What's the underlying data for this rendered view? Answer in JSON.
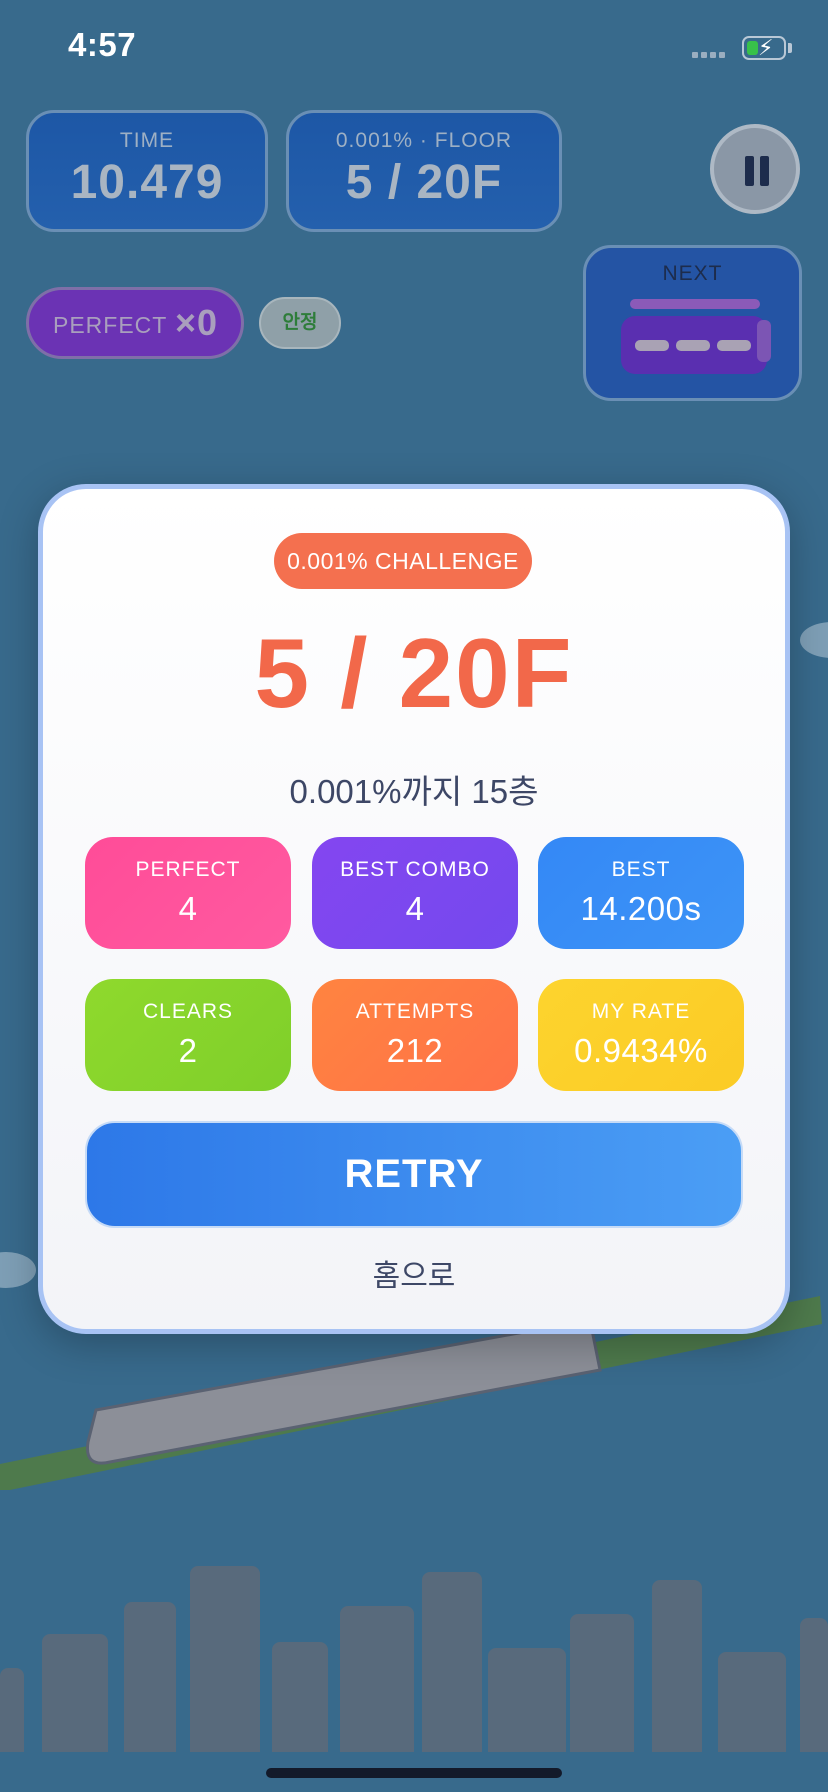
{
  "status_bar": {
    "time": "4:57"
  },
  "hud": {
    "time_label": "TIME",
    "time_value": "10.479",
    "floor_label": "0.001% · FLOOR",
    "floor_value": "5 / 20F",
    "combo_label": "PERFECT",
    "combo_value": "×0",
    "stability": "안정",
    "next_label": "NEXT"
  },
  "result": {
    "challenge_badge": "0.001% CHALLENGE",
    "floor": "5 / 20F",
    "remaining": "0.001%까지 15층",
    "stats": [
      {
        "label": "PERFECT",
        "value": "4",
        "color": "#ff4c98"
      },
      {
        "label": "BEST COMBO",
        "value": "4",
        "color": "#7b4af0"
      },
      {
        "label": "BEST",
        "value": "14.200s",
        "color": "#3a8ef6"
      },
      {
        "label": "CLEARS",
        "value": "2",
        "color": "#86d62b"
      },
      {
        "label": "ATTEMPTS",
        "value": "212",
        "color": "#ff7b45"
      },
      {
        "label": "MY RATE",
        "value": "0.9434%",
        "color": "#fcd12a"
      }
    ],
    "retry_label": "RETRY",
    "home_label": "홈으로"
  },
  "colors": {
    "background": "#386a8c",
    "accent": "#f2684a",
    "primary_button": "#3a8ef6"
  }
}
